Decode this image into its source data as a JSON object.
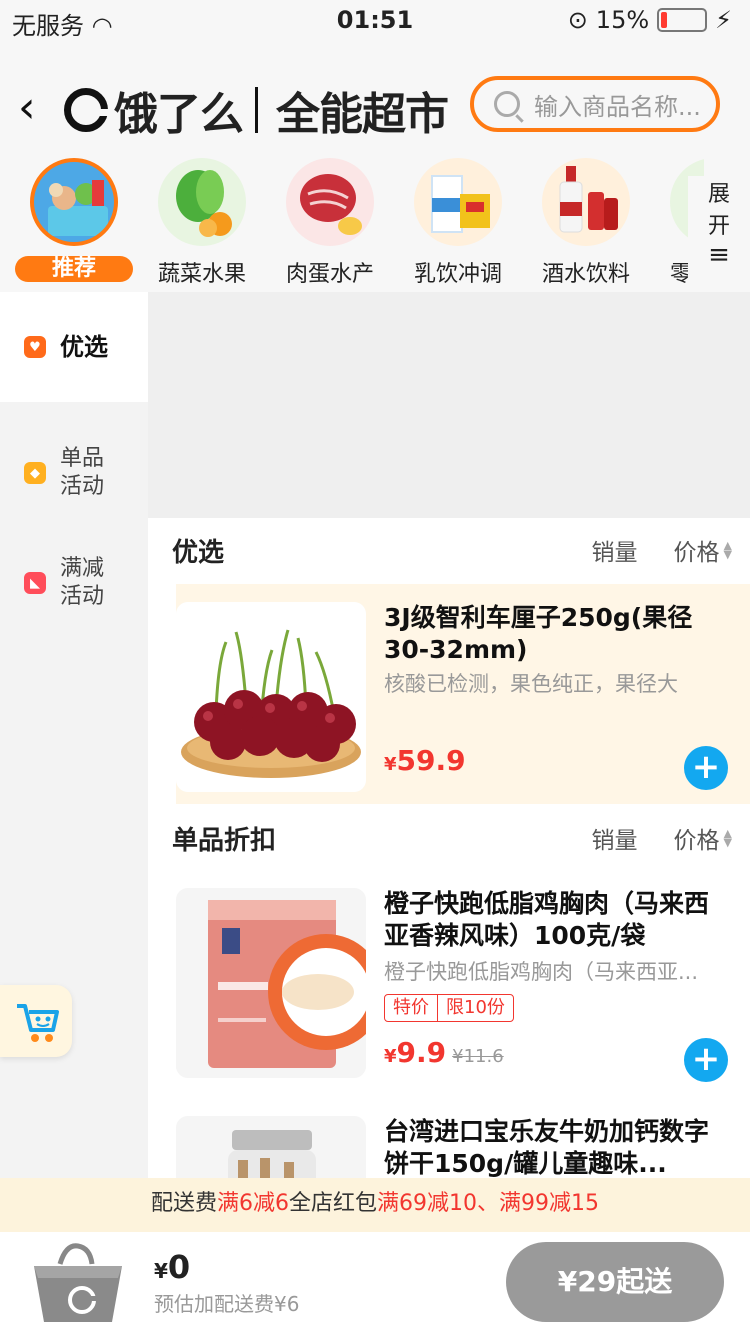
{
  "status_bar": {
    "carrier": "无服务",
    "time": "01:51",
    "battery": "15%",
    "battery_level": 0.15
  },
  "header": {
    "logo_text": "饿了么",
    "store_name": "全能超市",
    "search_placeholder": "输入商品名称..."
  },
  "categories": [
    {
      "label": "推荐",
      "active": true
    },
    {
      "label": "蔬菜水果"
    },
    {
      "label": "肉蛋水产"
    },
    {
      "label": "乳饮冲调"
    },
    {
      "label": "酒水饮料"
    },
    {
      "label": "零"
    }
  ],
  "expand": {
    "label_line1": "展",
    "label_line2": "开",
    "icon": "≡"
  },
  "sidebar": [
    {
      "label": "优选",
      "icon": "heart-icon",
      "color": "#ff6a1a",
      "active": true
    },
    {
      "label": "单品活动",
      "icon": "tag-icon",
      "color": "#ffb020"
    },
    {
      "label": "满减活动",
      "icon": "discount-icon",
      "color": "#ff4d5a"
    }
  ],
  "sections": {
    "featured": {
      "title": "优选",
      "sort_sales": "销量",
      "sort_price": "价格"
    },
    "discount": {
      "title": "单品折扣",
      "sort_sales": "销量",
      "sort_price": "价格"
    }
  },
  "products": [
    {
      "name": "3J级智利车厘子250g(果径30-32mm)",
      "desc": "核酸已检测，果色纯正，果径大",
      "currency": "¥",
      "price": "59.9"
    },
    {
      "name": "橙子快跑低脂鸡胸肉（马来西亚香辣风味）100克/袋",
      "desc": "橙子快跑低脂鸡胸肉（马来西亚...",
      "tag1": "特价",
      "tag2": "限10份",
      "currency": "¥",
      "price": "9.9",
      "old_price": "¥11.6"
    },
    {
      "name": "台湾进口宝乐友牛奶加钙数字饼干150g/罐儿童趣味..."
    }
  ],
  "promo": {
    "prefix": "配送费",
    "r1": "满6减6",
    "mid": "全店红包",
    "r2": "满69减10、满99减15"
  },
  "cart": {
    "currency": "¥",
    "total": "0",
    "fee_note": "预估加配送费¥6",
    "checkout": "¥29起送"
  }
}
